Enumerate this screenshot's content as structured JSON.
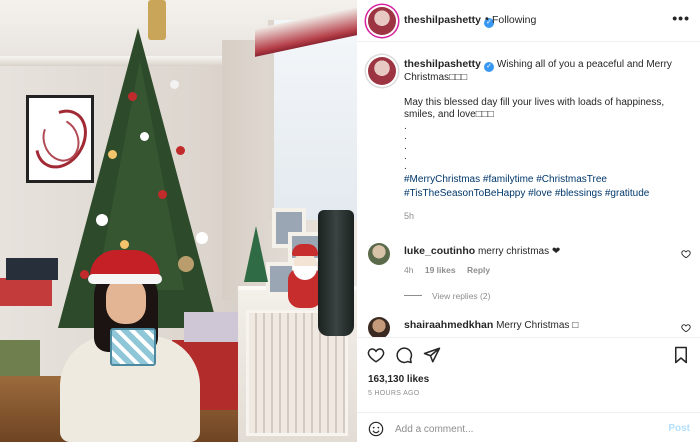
{
  "post": {
    "username": "theshilpashetty",
    "follow_status": "Following",
    "separator": "•",
    "more": "•••",
    "caption": {
      "line1": "Wishing all of you a peaceful and Merry Christmas□□□",
      "line2": "May this blessed day fill your lives with loads of happiness, smiles, and love□□□",
      "dots": ".",
      "hashtags_1": "#MerryChristmas #familytime #ChristmasTree",
      "hashtags_2": "#TisTheSeasonToBeHappy #love #blessings #gratitude",
      "time": "5h"
    },
    "comments": [
      {
        "username": "luke_coutinho",
        "text": "merry christmas ❤",
        "time": "4h",
        "likes": "19 likes",
        "reply": "Reply",
        "view_replies": "View replies (2)"
      },
      {
        "username": "shairaahmedkhan",
        "text": "Merry Christmas □"
      }
    ],
    "likes_count": "163,130 likes",
    "posted_ago": "5 HOURS AGO",
    "add_comment_placeholder": "Add a comment...",
    "post_label": "Post"
  },
  "icons": {
    "header_avatar": "profile-avatar",
    "like": "heart-icon",
    "comment": "comment-icon",
    "share": "send-icon",
    "save": "bookmark-icon",
    "emoji": "smiley-icon",
    "verified": "verified-badge-icon"
  },
  "colors": {
    "link": "#00376b",
    "verified": "#3897f0",
    "muted": "#8e8e8e",
    "post_button": "#b2dffc"
  }
}
